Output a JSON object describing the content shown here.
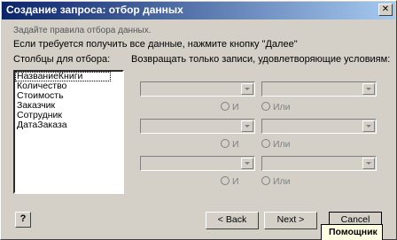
{
  "window": {
    "title": "Создание запроса: отбор данных",
    "close_glyph": "✕"
  },
  "intro": {
    "line1": "Задайте правила отбора данных.",
    "line2": "Если требуется получить все данные, нажмите кнопку \"Далее\""
  },
  "columns": {
    "label": "Столбцы для отбора:",
    "items": [
      "НазваниеКниги",
      "Количество",
      "Стоимость",
      "Заказчик",
      "Сотрудник",
      "ДатаЗаказа"
    ],
    "selected_index": 0
  },
  "conditions": {
    "label": "Возвращать только записи, удовлетворяющие условиям:",
    "and_label": "И",
    "or_label": "Или",
    "rows": 3
  },
  "buttons": {
    "help": "?",
    "back": "< Back",
    "next": "Next >",
    "cancel": "Cancel"
  },
  "assistant": {
    "label": "Помощник"
  }
}
